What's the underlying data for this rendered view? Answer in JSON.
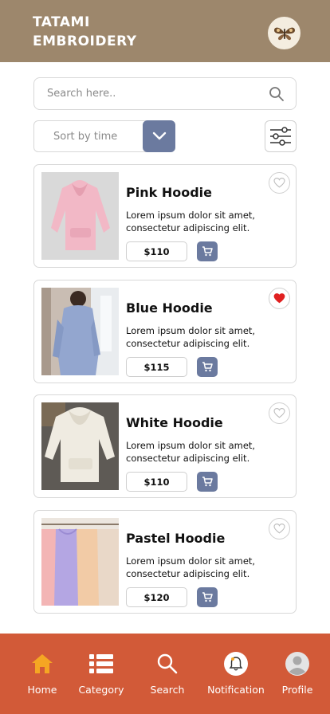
{
  "header": {
    "brand_line1": "TATAMI",
    "brand_line2": "EMBROIDERY",
    "logo_icon": "moth-logo-icon",
    "bg_color": "#9d876c"
  },
  "search": {
    "placeholder": "Search here..",
    "icon": "search-icon"
  },
  "sort": {
    "label": "Sort by time",
    "icon": "chevron-down-icon"
  },
  "filter": {
    "icon": "sliders-icon"
  },
  "products": [
    {
      "name": "Pink Hoodie",
      "description": "Lorem ipsum dolor sit amet, consectetur adipiscing elit.",
      "price": "$110",
      "favorited": false
    },
    {
      "name": "Blue Hoodie",
      "description": "Lorem ipsum dolor sit amet, consectetur adipiscing elit.",
      "price": "$115",
      "favorited": true
    },
    {
      "name": "White Hoodie",
      "description": "Lorem ipsum dolor sit amet, consectetur adipiscing elit.",
      "price": "$110",
      "favorited": false
    },
    {
      "name": "Pastel Hoodie",
      "description": "Lorem ipsum dolor sit amet, consectetur adipiscing elit.",
      "price": "$120",
      "favorited": false
    }
  ],
  "nav": {
    "items": [
      {
        "label": "Home",
        "icon": "home-icon",
        "active": true
      },
      {
        "label": "Category",
        "icon": "list-icon",
        "active": false
      },
      {
        "label": "Search",
        "icon": "search-icon",
        "active": false
      },
      {
        "label": "Notification",
        "icon": "bell-icon",
        "active": false
      },
      {
        "label": "Profile",
        "icon": "profile-icon",
        "active": false
      }
    ],
    "bg_color": "#d25a38",
    "active_color": "#f5a623"
  },
  "colors": {
    "accent": "#6b7a9f",
    "favorite": "#e02020"
  }
}
